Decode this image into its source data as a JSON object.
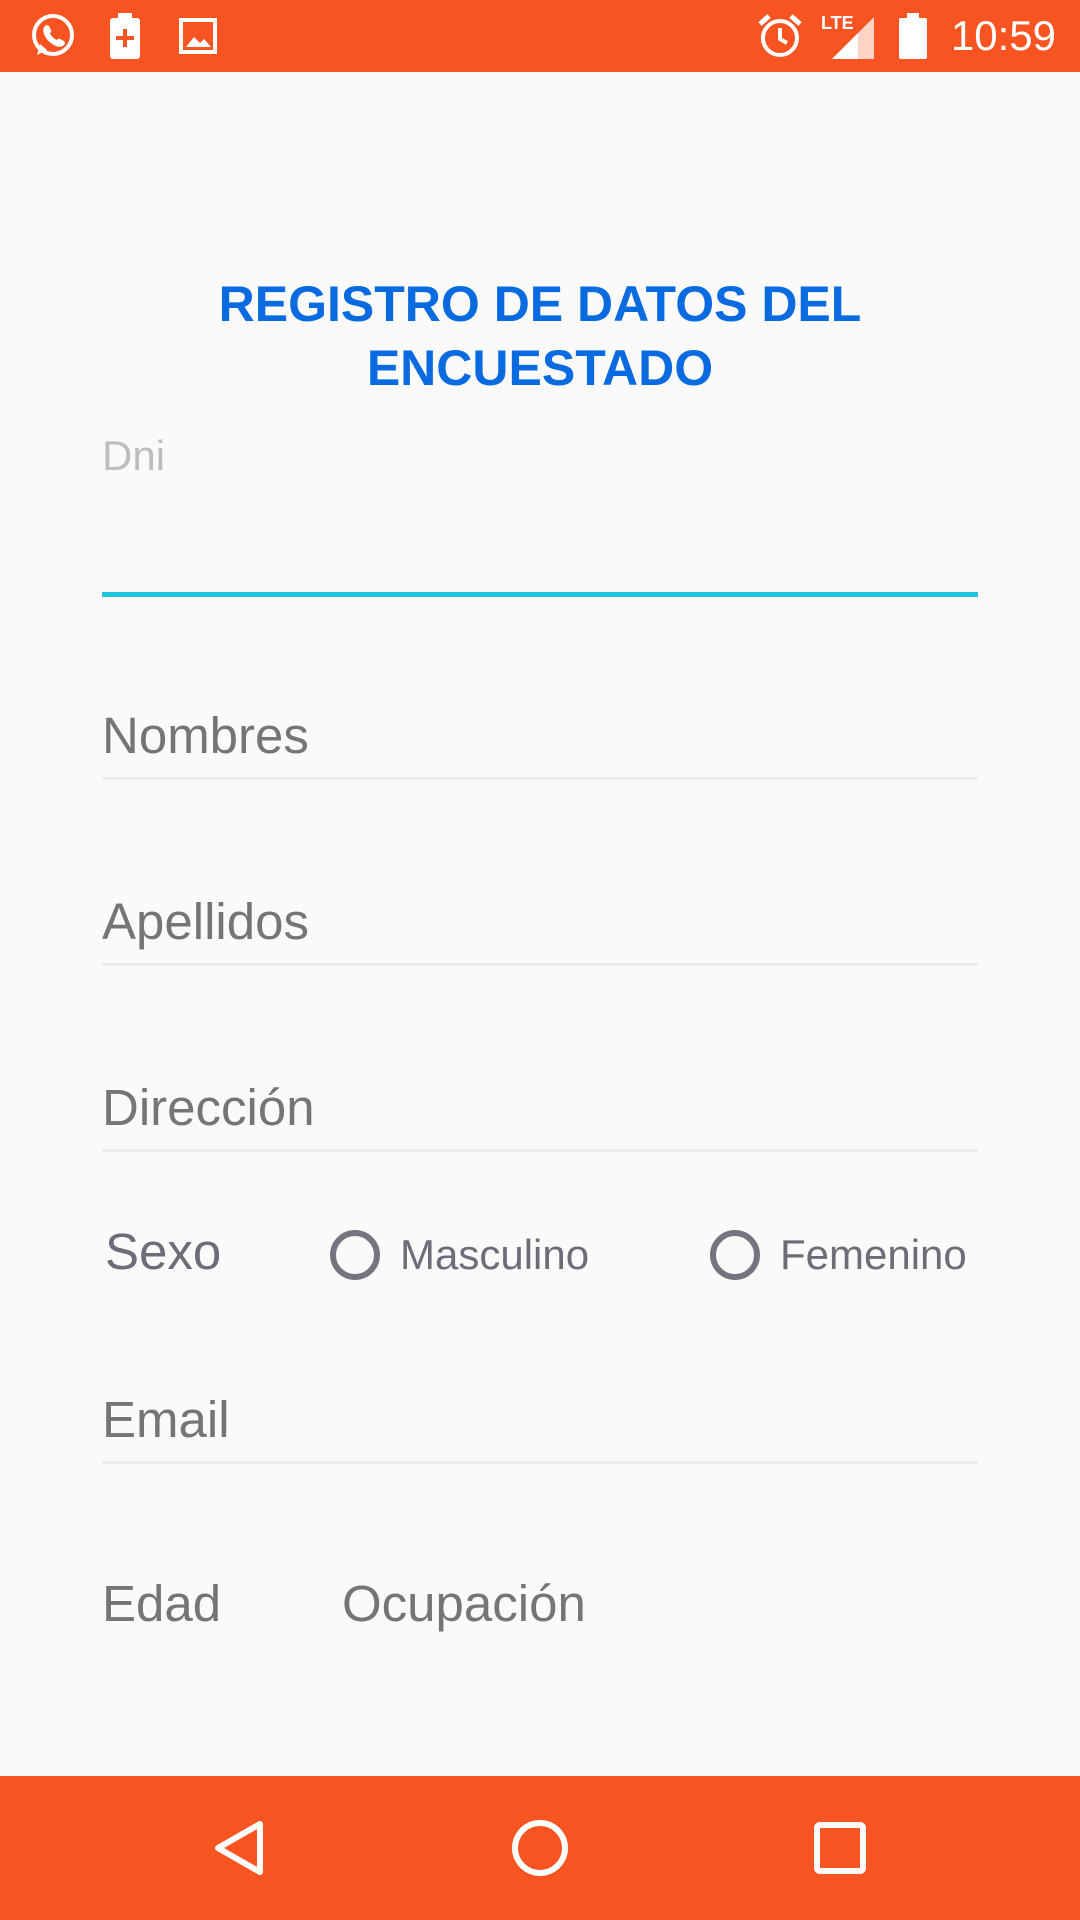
{
  "status_bar": {
    "time": "10:59",
    "left_icons": [
      "whatsapp-icon",
      "battery-saver-icon",
      "image-icon"
    ],
    "right_icons": [
      "alarm-icon",
      "lte-signal-icon",
      "battery-icon"
    ],
    "lte_text": "LTE"
  },
  "form": {
    "title_line1": "REGISTRO DE DATOS DEL",
    "title_line2": "ENCUESTADO",
    "dni_label": "Dni",
    "nombres_placeholder": "Nombres",
    "apellidos_placeholder": "Apellidos",
    "direccion_placeholder": "Dirección",
    "sexo_label": "Sexo",
    "sexo_options": [
      "Masculino",
      "Femenino"
    ],
    "email_placeholder": "Email",
    "edad_placeholder": "Edad",
    "ocupacion_placeholder": "Ocupación"
  },
  "nav_bar": {
    "buttons": [
      "back-icon",
      "home-icon",
      "recents-icon"
    ]
  },
  "colors": {
    "accent": "#f75421",
    "title": "#0a6be0",
    "focus_underline": "#1ec3df"
  }
}
